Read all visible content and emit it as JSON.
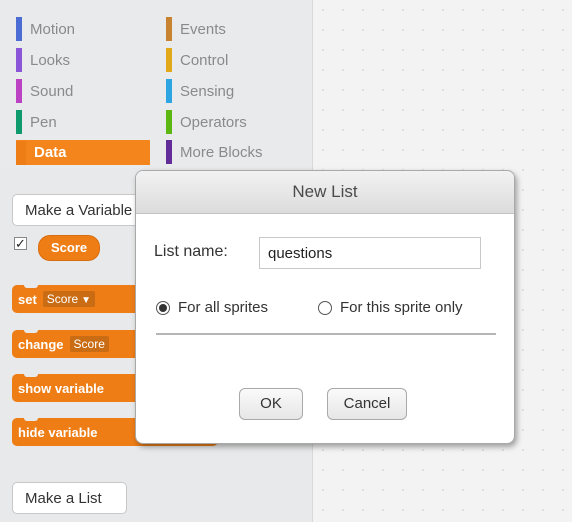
{
  "categories": [
    {
      "label": "Motion",
      "color": "#4a6cd4"
    },
    {
      "label": "Looks",
      "color": "#8a55d7"
    },
    {
      "label": "Sound",
      "color": "#bb42c3"
    },
    {
      "label": "Pen",
      "color": "#0e9a6c"
    },
    {
      "label": "Data",
      "color": "#ee7d16",
      "selected": true
    },
    {
      "label": "Events",
      "color": "#c88330"
    },
    {
      "label": "Control",
      "color": "#e1a91a"
    },
    {
      "label": "Sensing",
      "color": "#2ca5e2"
    },
    {
      "label": "Operators",
      "color": "#5cb712"
    },
    {
      "label": "More Blocks",
      "color": "#632d99"
    }
  ],
  "palette": {
    "make_variable_label": "Make a Variable",
    "variable_checked": true,
    "variable_name": "Score",
    "blocks": {
      "set_label": "set",
      "set_var": "Score",
      "change_label": "change",
      "change_var": "Score",
      "show_label": "show variable",
      "hide_label": "hide variable"
    },
    "make_list_label": "Make a List"
  },
  "dialog": {
    "title": "New List",
    "list_name_label": "List name:",
    "list_name_value": "questions",
    "option_all": "For all sprites",
    "option_this": "For this sprite only",
    "selected_option": "all",
    "ok_label": "OK",
    "cancel_label": "Cancel"
  }
}
